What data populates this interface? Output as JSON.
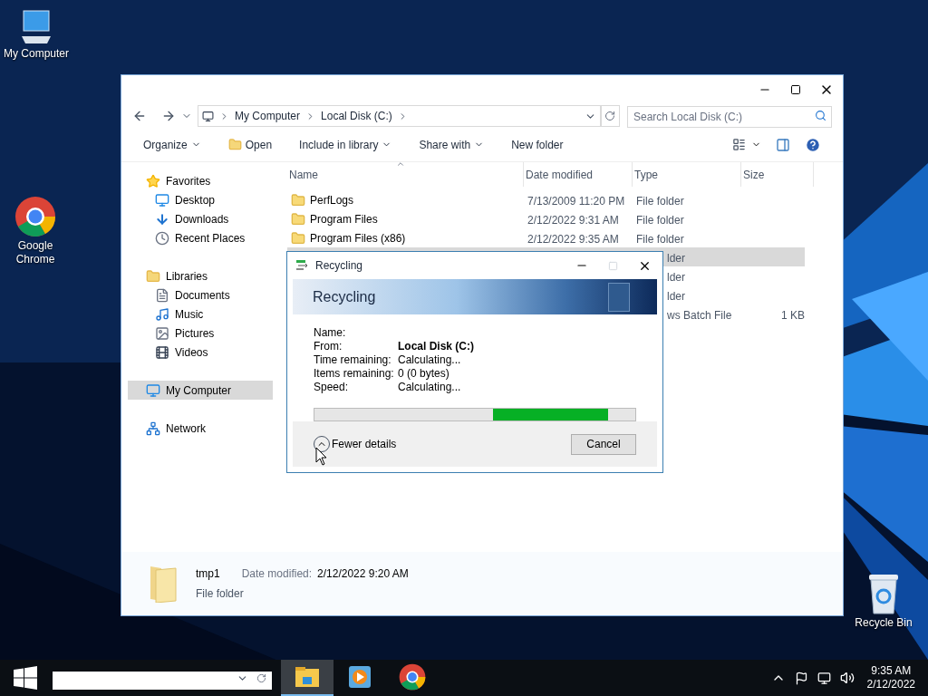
{
  "desktop_icons": [
    {
      "label": "My Computer",
      "kind": "computer"
    },
    {
      "label": "Google\nChrome",
      "kind": "chrome"
    },
    {
      "label": "Recycle Bin",
      "kind": "recycle"
    }
  ],
  "explorer": {
    "breadcrumb": [
      "My Computer",
      "Local Disk (C:)"
    ],
    "search": {
      "placeholder": "Search Local Disk (C:)"
    },
    "toolbar": [
      {
        "label": "Organize",
        "kind": "menu"
      },
      {
        "label": "Open",
        "kind": "open"
      },
      {
        "label": "Include in library",
        "kind": "menu"
      },
      {
        "label": "Share with",
        "kind": "menu"
      },
      {
        "label": "New folder",
        "kind": "plain"
      }
    ],
    "sidebar": [
      {
        "label": "Favorites",
        "selected": false,
        "children": [
          {
            "label": "Desktop",
            "selected": false
          },
          {
            "label": "Downloads",
            "selected": false
          },
          {
            "label": "Recent Places",
            "selected": false
          }
        ]
      },
      {
        "label": "Libraries",
        "selected": false,
        "children": [
          {
            "label": "Documents",
            "selected": false
          },
          {
            "label": "Music",
            "selected": false
          },
          {
            "label": "Pictures",
            "selected": false
          },
          {
            "label": "Videos",
            "selected": false
          }
        ]
      },
      {
        "label": "My Computer",
        "selected": true
      },
      {
        "label": "Network",
        "selected": false
      }
    ],
    "columns": [
      "Name",
      "Date modified",
      "Type",
      "Size"
    ],
    "rows": [
      {
        "name": "PerfLogs",
        "date": "7/13/2009 11:20 PM",
        "type": "File folder",
        "selected": false
      },
      {
        "name": "Program Files",
        "date": "2/12/2022 9:31 AM",
        "type": "File folder",
        "selected": false
      },
      {
        "name": "Program Files (x86)",
        "date": "2/12/2022 9:35 AM",
        "type": "File folder",
        "selected": false
      },
      {
        "type": "lder",
        "selected": true
      },
      {
        "type": "lder",
        "selected": false
      },
      {
        "type": "lder",
        "selected": false
      },
      {
        "type": "ws Batch File",
        "size": "1 KB",
        "selected": false
      }
    ],
    "details": {
      "name": "tmp1",
      "type": "File folder",
      "date_label": "Date modified:",
      "date": "2/12/2022 9:20 AM"
    }
  },
  "dialog": {
    "title": "Recycling",
    "header": "Recycling",
    "fields": [
      {
        "label": "Name:"
      },
      {
        "label": "From:",
        "value": "Local Disk (C:)",
        "kind": "strong"
      },
      {
        "label": "Time remaining:",
        "value": "Calculating...",
        "kind": "plain"
      },
      {
        "label": "Items remaining:",
        "value": "0 (0 bytes)",
        "kind": "plain"
      },
      {
        "label": "Speed:",
        "value": "Calculating...",
        "kind": "plain"
      }
    ],
    "details_toggle": {
      "label": "Fewer details",
      "expanded": true
    },
    "cancel": "Cancel"
  },
  "taskbar": {
    "apps": [
      {
        "kind": "explorer",
        "selected": true
      },
      {
        "kind": "media",
        "selected": false
      },
      {
        "kind": "chrome",
        "selected": false
      }
    ],
    "time": "9:35 AM",
    "date": "2/12/2022"
  }
}
